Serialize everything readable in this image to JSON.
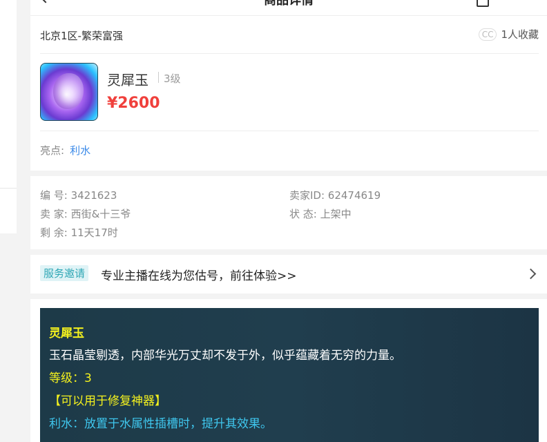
{
  "header": {
    "title": "商品详情"
  },
  "product": {
    "server": "北京1区-繁荣富强",
    "favorite_badge": "CC",
    "favorite_count": "1人收藏",
    "name": "灵犀玉",
    "level": "3级",
    "price": "¥2600",
    "highlight_label": "亮点:",
    "highlight_value": "利水"
  },
  "info": {
    "id": "编 号: 3421623",
    "seller_id": "卖家ID: 62474619",
    "seller": "卖 家: 西街&十三爷",
    "status": "状 态: 上架中",
    "remaining": "剩 余: 11天17时"
  },
  "service": {
    "tag": "服务邀请",
    "text": "专业主播在线为您估号，前往体验>>"
  },
  "description": {
    "title": "灵犀玉",
    "text": "玉石晶莹剔透，内部华光万丈却不发于外，似乎蕴藏着无穷的力量。",
    "level": "等级：3",
    "usage": "【可以用于修复神器】",
    "effect": "利水：放置于水属性插槽时，提升其效果。"
  },
  "colors": {
    "price": "#f0403c",
    "link": "#3b8ae8",
    "desc_bg": "#1f3c4b",
    "desc_yellow": "#f5f21e",
    "desc_cyan": "#3fc7ee"
  }
}
